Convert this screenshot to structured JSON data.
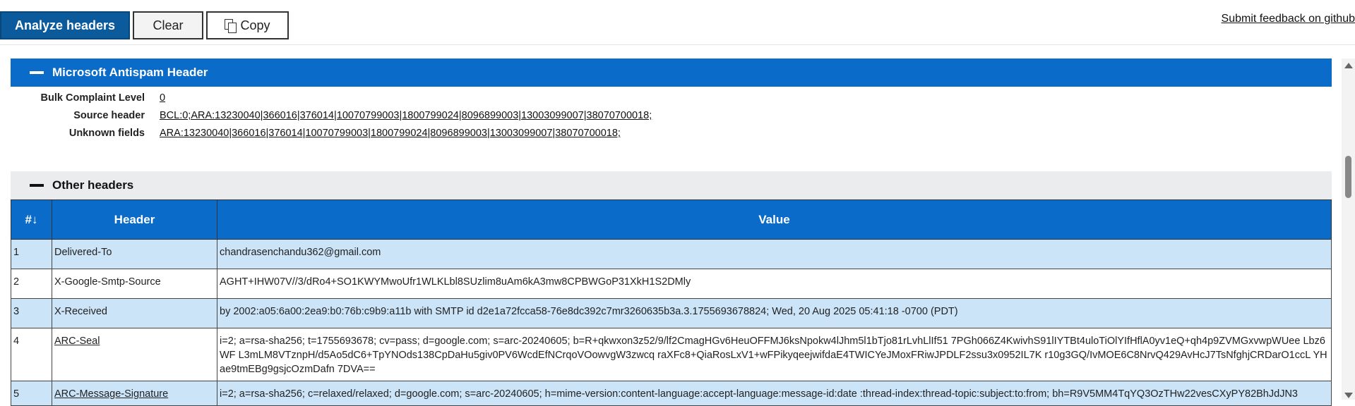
{
  "toolbar": {
    "analyze_label": "Analyze headers",
    "clear_label": "Clear",
    "copy_label": "Copy",
    "feedback_label": "Submit feedback on github"
  },
  "antispam": {
    "title": "Microsoft Antispam Header",
    "fields": [
      {
        "label": "Bulk Complaint Level",
        "value": "0"
      },
      {
        "label": "Source header",
        "value": "BCL:0;ARA:13230040|366016|376014|10070799003|1800799024|8096899003|13003099007|38070700018;"
      },
      {
        "label": "Unknown fields",
        "value": "ARA:13230040|366016|376014|10070799003|1800799024|8096899003|13003099007|38070700018;"
      }
    ]
  },
  "other_headers": {
    "title": "Other headers",
    "columns": [
      "#↓",
      "Header",
      "Value"
    ],
    "rows": [
      {
        "num": "1",
        "header": "Delivered-To",
        "value": "chandrasenchandu362@gmail.com"
      },
      {
        "num": "2",
        "header": "X-Google-Smtp-Source",
        "value": "AGHT+IHW07V//3/dRo4+SO1KWYMwoUfr1WLKLbl8SUzlim8uAm6kA3mw8CPBWGoP31XkH1S2DMly"
      },
      {
        "num": "3",
        "header": "X-Received",
        "value": "by 2002:a05:6a00:2ea9:b0:76b:c9b9:a11b with SMTP id d2e1a72fcca58-76e8dc392c7mr3260635b3a.3.1755693678824; Wed, 20 Aug 2025 05:41:18 -0700 (PDT)"
      },
      {
        "num": "4",
        "header": "ARC-Seal",
        "value": "i=2; a=rsa-sha256; t=1755693678; cv=pass; d=google.com; s=arc-20240605; b=R+qkwxon3z52/9/lf2CmagHGv6HeuOFFMJ6ksNpokw4lJhm5l1bTjo81rLvhLlIf51 7PGh066Z4KwivhS91lIYTBt4uloTiOlYIfHflA0yv1eQ+qh4p9ZVMGxvwpWUee Lbz6WF L3mLM8VTznpH/d5Ao5dC6+TpYNOds138CpDaHu5giv0PV6WcdEfNCrqoVOowvgW3zwcq raXFc8+QiaRosLxV1+wFPikyqeejwifdaE4TWICYeJMoxFRiwJPDLF2ssu3x0952IL7K r10g3GQ/IvMOE6C8NrvQ429AvHcJ7TsNfghjCRDarO1ccL YHae9tmEBg9gsjcOzmDafn 7DVA=="
      },
      {
        "num": "5",
        "header": "ARC-Message-Signature",
        "value": "i=2; a=rsa-sha256; c=relaxed/relaxed; d=google.com; s=arc-20240605; h=mime-version:content-language:accept-language:message-id:date :thread-index:thread-topic:subject:to:from; bh=R9V5MM4TqYQ3OzTHw22vesCXyPY82BhJdJN3"
      }
    ]
  }
}
